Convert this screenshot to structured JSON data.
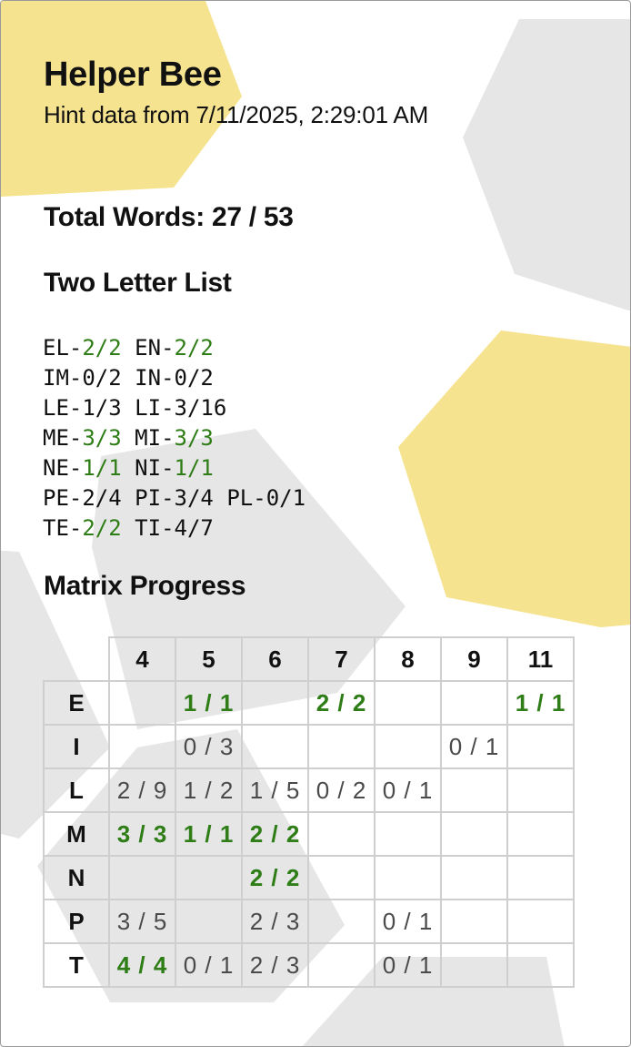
{
  "header": {
    "title": "Helper Bee",
    "subtitle": "Hint data from 7/11/2025, 2:29:01 AM"
  },
  "total_words": "Total Words: 27 / 53",
  "two_letter": {
    "heading": "Two Letter List",
    "lines": [
      [
        {
          "p": "EL",
          "c": "2/2",
          "done": true
        },
        {
          "p": "EN",
          "c": "2/2",
          "done": true
        }
      ],
      [
        {
          "p": "IM",
          "c": "0/2",
          "done": false
        },
        {
          "p": "IN",
          "c": "0/2",
          "done": false
        }
      ],
      [
        {
          "p": "LE",
          "c": "1/3",
          "done": false
        },
        {
          "p": "LI",
          "c": "3/16",
          "done": false
        }
      ],
      [
        {
          "p": "ME",
          "c": "3/3",
          "done": true
        },
        {
          "p": "MI",
          "c": "3/3",
          "done": true
        }
      ],
      [
        {
          "p": "NE",
          "c": "1/1",
          "done": true
        },
        {
          "p": "NI",
          "c": "1/1",
          "done": true
        }
      ],
      [
        {
          "p": "PE",
          "c": "2/4",
          "done": false
        },
        {
          "p": "PI",
          "c": "3/4",
          "done": false
        },
        {
          "p": "PL",
          "c": "0/1",
          "done": false
        }
      ],
      [
        {
          "p": "TE",
          "c": "2/2",
          "done": true
        },
        {
          "p": "TI",
          "c": "4/7",
          "done": false
        }
      ]
    ]
  },
  "matrix": {
    "heading": "Matrix Progress",
    "columns": [
      "4",
      "5",
      "6",
      "7",
      "8",
      "9",
      "11"
    ],
    "rows": [
      {
        "letter": "E",
        "cells": [
          "",
          "1 / 1",
          "",
          "2 / 2",
          "",
          "",
          "1 / 1"
        ]
      },
      {
        "letter": "I",
        "cells": [
          "",
          "0 / 3",
          "",
          "",
          "",
          "0 / 1",
          ""
        ]
      },
      {
        "letter": "L",
        "cells": [
          "2 / 9",
          "1 / 2",
          "1 / 5",
          "0 / 2",
          "0 / 1",
          "",
          ""
        ]
      },
      {
        "letter": "M",
        "cells": [
          "3 / 3",
          "1 / 1",
          "2 / 2",
          "",
          "",
          "",
          ""
        ]
      },
      {
        "letter": "N",
        "cells": [
          "",
          "",
          "2 / 2",
          "",
          "",
          "",
          ""
        ]
      },
      {
        "letter": "P",
        "cells": [
          "3 / 5",
          "",
          "2 / 3",
          "",
          "0 / 1",
          "",
          ""
        ]
      },
      {
        "letter": "T",
        "cells": [
          "4 / 4",
          "0 / 1",
          "2 / 3",
          "",
          "0 / 1",
          "",
          ""
        ]
      }
    ]
  },
  "colors": {
    "complete": "#2e7d16",
    "incomplete": "#4a4a4a",
    "hex_yellow": "#f5e38f",
    "hex_gray": "#e6e6e6"
  }
}
